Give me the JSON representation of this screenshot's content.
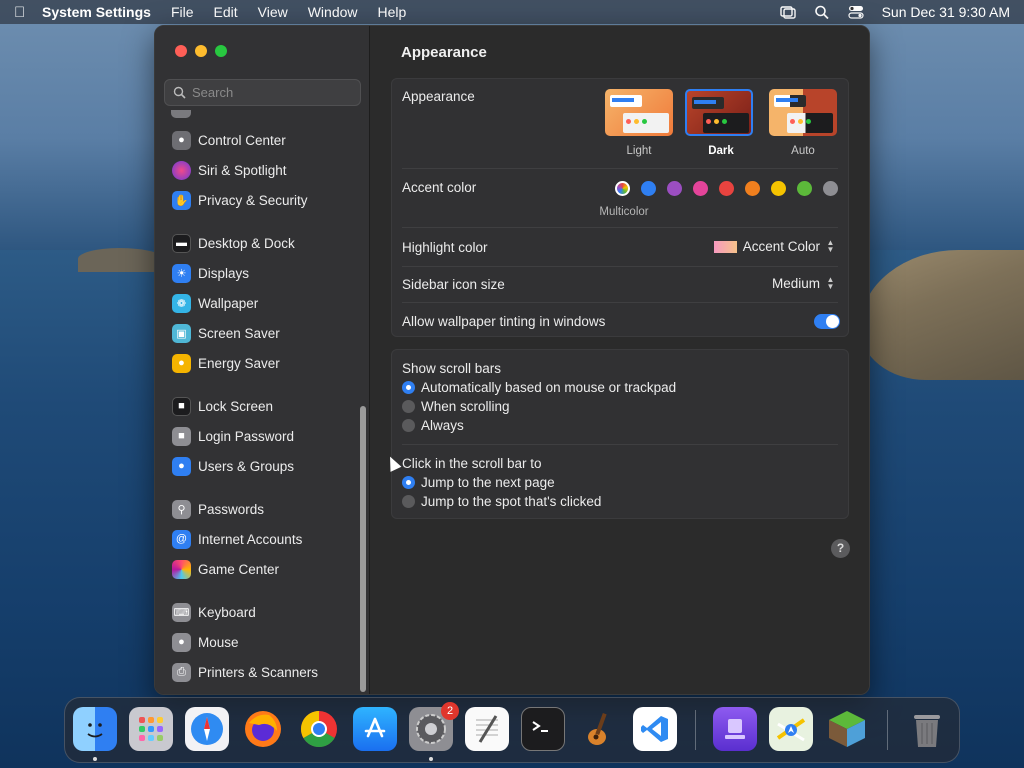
{
  "menubar": {
    "app_name": "System Settings",
    "menus": [
      "File",
      "Edit",
      "View",
      "Window",
      "Help"
    ],
    "clock": "Sun Dec 31  9:30 AM"
  },
  "sidebar": {
    "search_placeholder": "Search",
    "items": [
      {
        "label": "Control Center",
        "icon": "control-center-icon",
        "color": "#6e6e73"
      },
      {
        "label": "Siri & Spotlight",
        "icon": "siri-icon",
        "color": "#b23fd0"
      },
      {
        "label": "Privacy & Security",
        "icon": "hand-icon",
        "color": "#2f7ff2"
      },
      {
        "label": "Desktop & Dock",
        "icon": "dock-icon",
        "color": "#1c1c1e"
      },
      {
        "label": "Displays",
        "icon": "sun-icon",
        "color": "#2f7ff2"
      },
      {
        "label": "Wallpaper",
        "icon": "flower-icon",
        "color": "#34b4e6"
      },
      {
        "label": "Screen Saver",
        "icon": "screen-saver-icon",
        "color": "#4fb7d6"
      },
      {
        "label": "Energy Saver",
        "icon": "bulb-icon",
        "color": "#f5b400"
      },
      {
        "label": "Lock Screen",
        "icon": "lock-icon",
        "color": "#1c1c1e"
      },
      {
        "label": "Login Password",
        "icon": "lock-icon",
        "color": "#8e8e93"
      },
      {
        "label": "Users & Groups",
        "icon": "users-icon",
        "color": "#2f7ff2"
      },
      {
        "label": "Passwords",
        "icon": "key-icon",
        "color": "#8e8e93"
      },
      {
        "label": "Internet Accounts",
        "icon": "at-icon",
        "color": "#2f7ff2"
      },
      {
        "label": "Game Center",
        "icon": "game-center-icon",
        "color": "#ffffff"
      },
      {
        "label": "Keyboard",
        "icon": "keyboard-icon",
        "color": "#8e8e93"
      },
      {
        "label": "Mouse",
        "icon": "mouse-icon",
        "color": "#8e8e93"
      },
      {
        "label": "Printers & Scanners",
        "icon": "printer-icon",
        "color": "#8e8e93"
      }
    ]
  },
  "main": {
    "title": "Appearance",
    "appearance": {
      "label": "Appearance",
      "options": [
        "Light",
        "Dark",
        "Auto"
      ],
      "selected": "Dark"
    },
    "accent": {
      "label": "Accent color",
      "selected_name": "Multicolor",
      "colors": [
        "multicolor",
        "#2f7ff2",
        "#9b4ec1",
        "#e4449a",
        "#e8433f",
        "#f07f1e",
        "#f5c300",
        "#5cb93a",
        "#8e8e93"
      ]
    },
    "highlight": {
      "label": "Highlight color",
      "value": "Accent Color"
    },
    "sidebar_icon": {
      "label": "Sidebar icon size",
      "value": "Medium"
    },
    "tinting": {
      "label": "Allow wallpaper tinting in windows",
      "on": true
    },
    "scroll_bars": {
      "label": "Show scroll bars",
      "options": [
        "Automatically based on mouse or trackpad",
        "When scrolling",
        "Always"
      ],
      "selected": 0
    },
    "click_scroll": {
      "label": "Click in the scroll bar to",
      "options": [
        "Jump to the next page",
        "Jump to the spot that's clicked"
      ],
      "selected": 0
    },
    "help": "?"
  },
  "dock": {
    "apps": [
      "finder-icon",
      "launchpad-icon",
      "safari-icon",
      "firefox-icon",
      "chrome-icon",
      "app-store-icon",
      "system-settings-icon",
      "textedit-icon",
      "terminal-icon",
      "garageband-icon",
      "vscode-icon",
      "apple-configurator-icon",
      "maps-icon",
      "minecraft-icon",
      "trash-icon"
    ],
    "settings_badge": "2"
  }
}
